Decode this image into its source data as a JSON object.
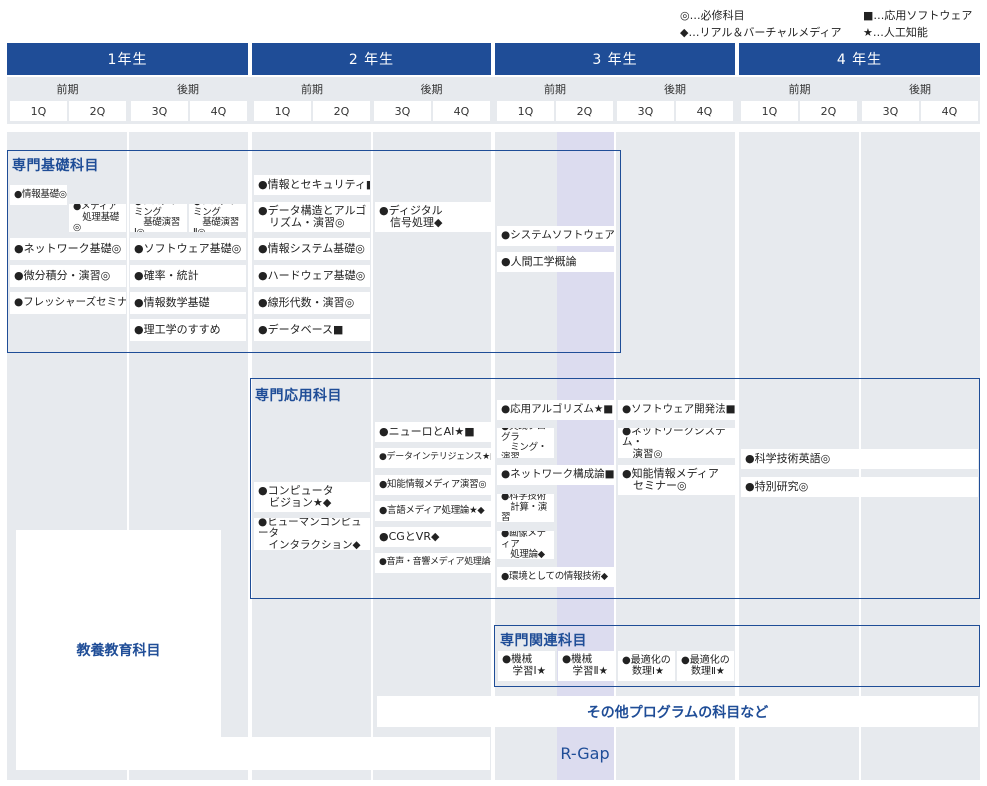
{
  "legend": {
    "required": "◎…必修科目",
    "applied_software": "■…応用ソフトウェア",
    "real_virtual": "◆…リアル＆バーチャルメディア",
    "ai": "★…人工知能"
  },
  "years": [
    "1年生",
    "2 年生",
    "3 年生",
    "4 年生"
  ],
  "halves": [
    "前期",
    "後期",
    "前期",
    "後期",
    "前期",
    "後期",
    "前期",
    "後期"
  ],
  "quarters": [
    "1Q",
    "2Q",
    "3Q",
    "4Q",
    "1Q",
    "2Q",
    "3Q",
    "4Q",
    "1Q",
    "2Q",
    "3Q",
    "4Q",
    "1Q",
    "2Q",
    "3Q",
    "4Q"
  ],
  "sections": {
    "basic": "専門基礎科目",
    "applied": "専門応用科目",
    "related": "専門関連科目",
    "liberal": "教養教育科目",
    "other": "その他プログラムの科目など",
    "rgap": "R-Gap"
  },
  "courses": {
    "c1": "●情報基礎◎",
    "c2": "●メディア\n　処理基礎◎",
    "c3": "●プログラミング\n　基礎演習Ⅰ◎",
    "c4": "●プログラミング\n　基礎演習Ⅱ◎",
    "c5": "●ネットワーク基礎◎",
    "c6": "●ソフトウェア基礎◎",
    "c7": "●微分積分・演習◎",
    "c8": "●確率・統計",
    "c9": "●フレッシャーズセミナー",
    "c10": "●情報数学基礎",
    "c11": "●理工学のすすめ",
    "c12": "●情報とセキュリティ■",
    "c13": "●データ構造とアルゴ\n　リズム・演習◎",
    "c14": "●ディジタル\n　信号処理◆",
    "c15": "●情報システム基礎◎",
    "c16": "●ハードウェア基礎◎",
    "c17": "●線形代数・演習◎",
    "c18": "●データベース■",
    "c19": "●システムソフトウェア■",
    "c20": "●人間工学概論",
    "a1": "●応用アルゴリズム★■",
    "a2": "●ソフトウェア開発法■",
    "a3": "●ニューロとAI★■",
    "a4": "●実践プログラ\n　ミング・演習",
    "a5": "●ネットワークシステム・\n　演習◎",
    "a6": "●データインテリジェンス★■",
    "a7": "●ネットワーク構成論■",
    "a8": "●知能情報メディア\n　セミナー◎",
    "a9": "●科学技術英語◎",
    "a10": "●知能情報メディア演習◎",
    "a11": "●特別研究◎",
    "a12": "●コンピュータ\n　ビジョン★◆",
    "a13": "●科学技術\n　計算・演習",
    "a14": "●言語メディア処理論★◆",
    "a15": "●ヒューマンコンピュータ\n　インタラクション◆",
    "a16": "●CGとVR◆",
    "a17": "●画像メディア\n　処理論◆",
    "a18": "●音声・音響メディア処理論◆",
    "a19": "●環境としての情報技術◆",
    "r1": "●機械\n　学習Ⅰ★",
    "r2": "●機械\n　学習Ⅱ★",
    "r3": "●最適化の\n　数理Ⅰ★",
    "r4": "●最適化の\n　数理Ⅱ★"
  }
}
